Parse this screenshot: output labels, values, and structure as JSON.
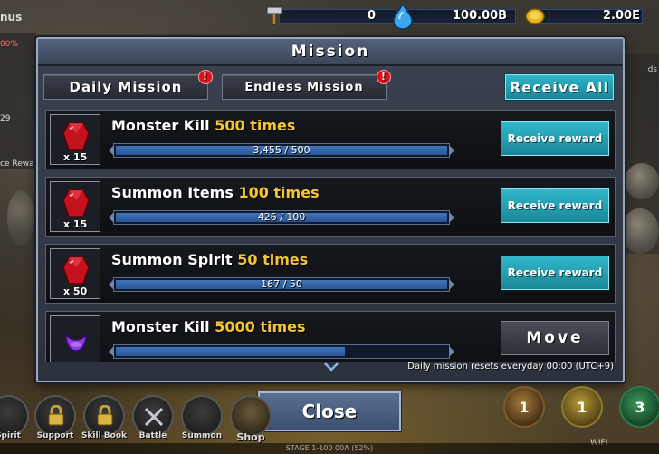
{
  "top_bar": {
    "hammer_value": "0",
    "gem_value": "100.00B",
    "gold_value": "2.00E"
  },
  "panel": {
    "title": "Mission",
    "tabs": [
      {
        "label": "Daily Mission",
        "alert": "!"
      },
      {
        "label": "Endless Mission",
        "alert": "!"
      }
    ],
    "receive_all_label": "Receive All",
    "footer_note": "Daily mission resets everyday 00:00 (UTC+9)"
  },
  "missions": [
    {
      "name": "Monster Kill",
      "target": "500 times",
      "progress_text": "3,455 / 500",
      "progress": 1.0,
      "reward_icon": "red-gem-icon",
      "reward_qty": "x 15",
      "button": "Receive reward"
    },
    {
      "name": "Summon Items",
      "target": "100 times",
      "progress_text": "426 / 100",
      "progress": 1.0,
      "reward_icon": "red-gem-icon",
      "reward_qty": "x 15",
      "button": "Receive reward"
    },
    {
      "name": "Summon Spirit",
      "target": "50 times",
      "progress_text": "167 / 50",
      "progress": 1.0,
      "reward_icon": "red-gem-icon",
      "reward_qty": "x 50",
      "button": "Receive reward"
    },
    {
      "name": "Monster Kill",
      "target": "5000 times",
      "progress_text": "",
      "progress": 0.69,
      "reward_icon": "purple-orb-icon",
      "reward_qty": "",
      "button": "Move"
    }
  ],
  "close_label": "Close",
  "background": {
    "left_top": "nus",
    "left_pct": "00%",
    "left_num": "29",
    "left_reward": "ce Rewa",
    "right_top": "ds",
    "nav": [
      {
        "label": "Spirit",
        "icon": "spirit-icon"
      },
      {
        "label": "Support",
        "icon": "lock-icon"
      },
      {
        "label": "Skill Book",
        "icon": "lock-icon"
      },
      {
        "label": "Battle",
        "icon": "swords-icon"
      },
      {
        "label": "Summon",
        "icon": "summon-icon"
      },
      {
        "label": "Shop",
        "icon": "chest-icon"
      }
    ],
    "orb_labels": [
      "1",
      "1",
      "3"
    ],
    "wifi_label": "WIFI",
    "status_text": "STAGE 1-100 00A (52%)"
  },
  "colors": {
    "accent_cyan": "#2fb7c9",
    "target_yellow": "#f5c531",
    "bar_blue": "#3f73b8",
    "alert_red": "#d8141c"
  }
}
